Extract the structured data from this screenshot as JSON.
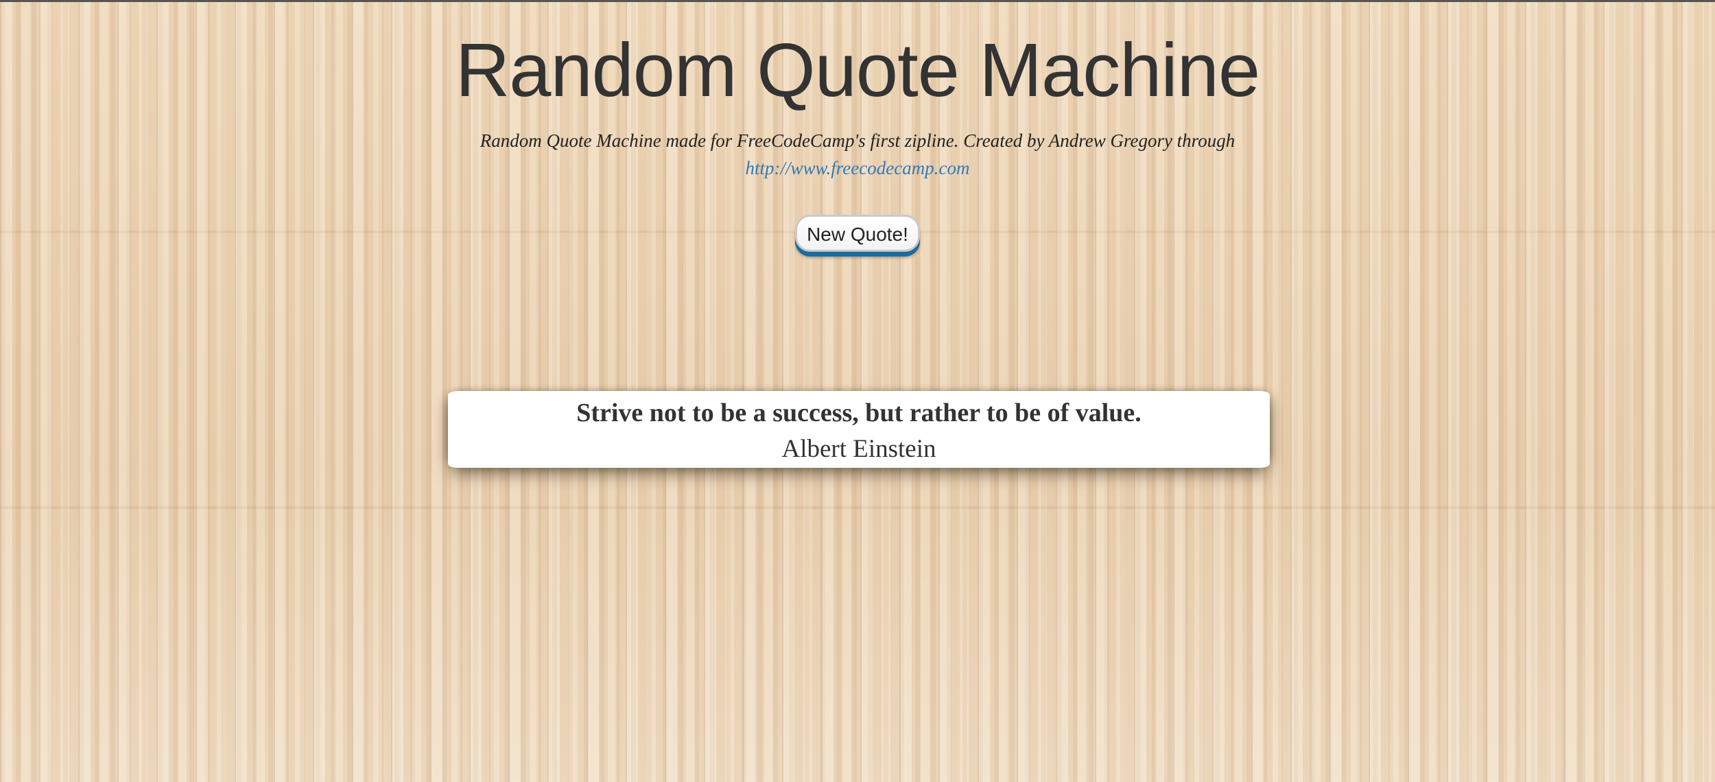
{
  "header": {
    "title": "Random Quote Machine",
    "subtitle": "Random Quote Machine made for FreeCodeCamp's first zipline. Created by Andrew Gregory through",
    "link_text": "http://www.freecodecamp.com"
  },
  "controls": {
    "new_quote_label": "New Quote!"
  },
  "quote": {
    "text": "Strive not to be a success, but rather to be of value.",
    "author": "Albert Einstein"
  },
  "colors": {
    "link": "#337ab7",
    "button_shadow": "#1d6aa0",
    "text": "#333333"
  }
}
